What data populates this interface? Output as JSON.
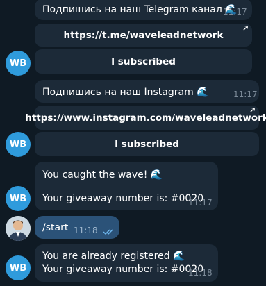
{
  "msg1": {
    "text": "Подпишись на наш Telegram канал 🌊",
    "time": "11:17",
    "link": "https://t.me/waveleadnetwork",
    "button": "I subscribed"
  },
  "msg2": {
    "text": "Подпишись на наш Instagram 🌊",
    "time": "11:17",
    "link": "https://www.instagram.com/waveleadnetwork",
    "button": "I subscribed"
  },
  "msg3": {
    "line1": "You caught the wave! 🌊",
    "line2": "Your giveaway number is: #0020",
    "time": "11:17"
  },
  "msg4": {
    "text": "/start",
    "time": "11:18"
  },
  "msg5": {
    "line1": "You are already registered 🌊",
    "line2": "Your giveaway number is: #0020",
    "time": "11:18"
  },
  "bot": {
    "avatar_initials": "WB",
    "avatar_color": "#2f9bdc"
  },
  "colors": {
    "background": "#0f1a24",
    "bubble": "#1c2a38",
    "outgoing": "#2b5278",
    "time": "#7d8b99"
  }
}
